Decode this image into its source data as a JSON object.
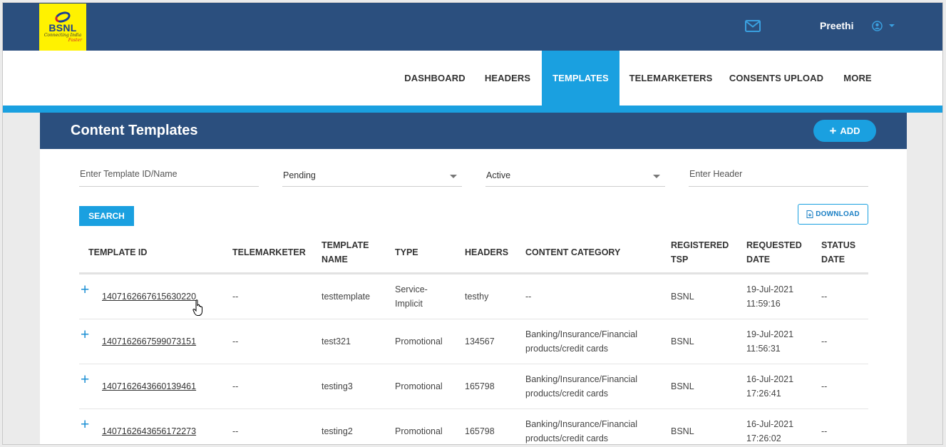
{
  "header": {
    "logo": {
      "brand": "BSNL",
      "tagline": "Connecting India",
      "tagline2": "Faster"
    },
    "user_name": "Preethi",
    "icons": {
      "mail": "mail-icon",
      "user": "user-circle-icon",
      "caret": "caret-down-icon"
    }
  },
  "nav": {
    "items": [
      {
        "label": "DASHBOARD",
        "active": false
      },
      {
        "label": "HEADERS",
        "active": false
      },
      {
        "label": "TEMPLATES",
        "active": true
      },
      {
        "label": "TELEMARKETERS",
        "active": false
      },
      {
        "label": "CONSENTS UPLOAD",
        "active": false
      },
      {
        "label": "MORE",
        "active": false
      }
    ]
  },
  "page": {
    "title": "Content Templates",
    "add_label": "ADD",
    "filters": {
      "template_placeholder": "Enter Template ID/Name",
      "status_value": "Pending",
      "state_value": "Active",
      "header_placeholder": "Enter Header"
    },
    "search_label": "SEARCH",
    "download_label": "DOWNLOAD"
  },
  "table": {
    "columns": [
      {
        "line1": "TEMPLATE ID",
        "line2": ""
      },
      {
        "line1": "TELEMARKETER",
        "line2": ""
      },
      {
        "line1": "TEMPLATE",
        "line2": "NAME"
      },
      {
        "line1": "TYPE",
        "line2": ""
      },
      {
        "line1": "HEADERS",
        "line2": ""
      },
      {
        "line1": "CONTENT CATEGORY",
        "line2": ""
      },
      {
        "line1": "REGISTERED",
        "line2": "TSP"
      },
      {
        "line1": "REQUESTED",
        "line2": "DATE"
      },
      {
        "line1": "STATUS",
        "line2": "DATE"
      }
    ],
    "rows": [
      {
        "template_id": "1407162667615630220",
        "telemarketer": "--",
        "template_name": "testtemplate",
        "type_line1": "Service-",
        "type_line2": "Implicit",
        "headers": "testhy",
        "category_line1": "--",
        "category_line2": "",
        "tsp": "BSNL",
        "date_line1": "19-Jul-2021",
        "date_line2": "11:59:16",
        "status_date": "--"
      },
      {
        "template_id": "1407162667599073151",
        "telemarketer": "--",
        "template_name": "test321",
        "type_line1": "Promotional",
        "type_line2": "",
        "headers": "134567",
        "category_line1": "Banking/Insurance/Financial",
        "category_line2": "products/credit cards",
        "tsp": "BSNL",
        "date_line1": "19-Jul-2021",
        "date_line2": "11:56:31",
        "status_date": "--"
      },
      {
        "template_id": "1407162643660139461",
        "telemarketer": "--",
        "template_name": "testing3",
        "type_line1": "Promotional",
        "type_line2": "",
        "headers": "165798",
        "category_line1": "Banking/Insurance/Financial",
        "category_line2": "products/credit cards",
        "tsp": "BSNL",
        "date_line1": "16-Jul-2021",
        "date_line2": "17:26:41",
        "status_date": "--"
      },
      {
        "template_id": "1407162643656172273",
        "telemarketer": "--",
        "template_name": "testing2",
        "type_line1": "Promotional",
        "type_line2": "",
        "headers": "165798",
        "category_line1": "Banking/Insurance/Financial",
        "category_line2": "products/credit cards",
        "tsp": "BSNL",
        "date_line1": "16-Jul-2021",
        "date_line2": "17:26:02",
        "status_date": "--"
      }
    ]
  },
  "colors": {
    "navy": "#2b4f7e",
    "accent_blue": "#1aa0e0",
    "logo_yellow": "#fff200"
  }
}
